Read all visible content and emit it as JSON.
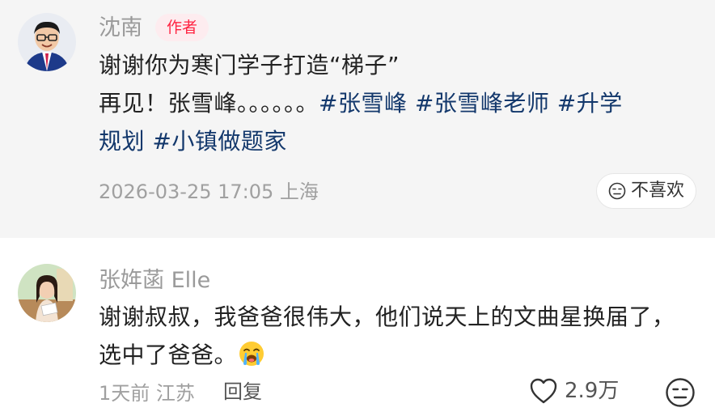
{
  "comments": [
    {
      "username": "沈南",
      "badge": "作者",
      "text_line1": "谢谢你为寒门学子打造“梯子”",
      "text_line2_plain": "再见！张雪峰。。。。。。",
      "hashtags": [
        "#张雪峰",
        "#张雪峰老师",
        "#升学规划",
        "#小镇做题家"
      ],
      "hashtag_3_part1": "#升学",
      "hashtag_3_part2": "规划",
      "timestamp": "2026-03-25 17:05",
      "location": "上海",
      "dislike_label": "不喜欢",
      "avatar_icon": "avatar-man-with-glasses",
      "background": "#f5f5f5"
    },
    {
      "username": "张姩菡 Elle",
      "text_line1": "谢谢叔叔，我爸爸很伟大，他们说天上的文曲星换届了，",
      "text_line2": "选中了爸爸。",
      "emoji": "crying-face-emoji",
      "time_ago": "1天前",
      "location": "江苏",
      "reply_label": "回复",
      "like_count": "2.9万",
      "avatar_icon": "avatar-girl-reading"
    }
  ],
  "colors": {
    "hashtag": "#13386c",
    "badge_text": "#ff2442",
    "badge_bg": "#fdecef",
    "meta_text": "#a0a0a0"
  }
}
